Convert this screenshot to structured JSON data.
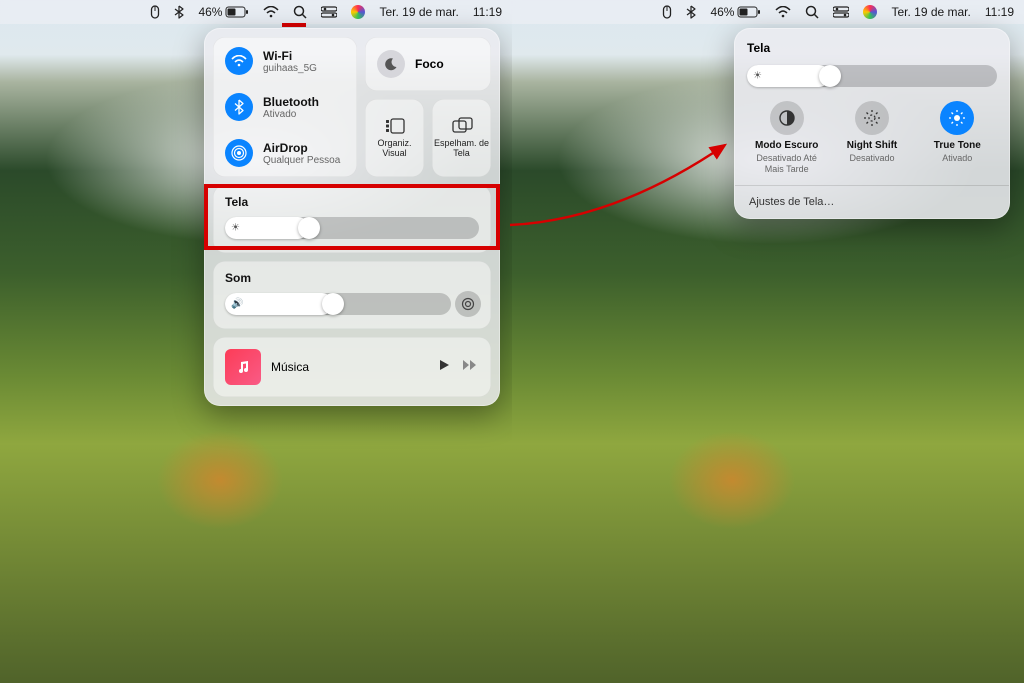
{
  "menubar": {
    "battery": "46%",
    "date": "Ter. 19 de mar.",
    "time": "11:19"
  },
  "cc": {
    "wifi": {
      "title": "Wi-Fi",
      "sub": "guihaas_5G"
    },
    "bluetooth": {
      "title": "Bluetooth",
      "sub": "Ativado"
    },
    "airdrop": {
      "title": "AirDrop",
      "sub": "Qualquer Pessoa"
    },
    "focus": "Foco",
    "stage": "Organiz. Visual",
    "mirror": "Espelham. de Tela",
    "tela": {
      "title": "Tela",
      "brightness_pct": 33
    },
    "som": {
      "title": "Som",
      "volume_pct": 48
    },
    "music": "Música"
  },
  "disp": {
    "title": "Tela",
    "brightness_pct": 33,
    "dark": {
      "label": "Modo Escuro",
      "status": "Desativado Até Mais Tarde"
    },
    "night": {
      "label": "Night Shift",
      "status": "Desativado"
    },
    "truetone": {
      "label": "True Tone",
      "status": "Ativado"
    },
    "settings": "Ajustes de Tela…"
  }
}
